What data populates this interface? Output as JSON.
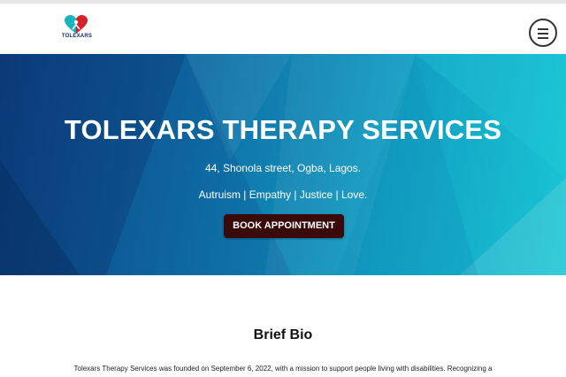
{
  "header": {
    "logo_text": "TOLEXARS",
    "logo_subtext": "",
    "menu_icon": "hamburger-icon"
  },
  "hero": {
    "title": "TOLEXARS THERAPY SERVICES",
    "address": "44, Shonola street, Ogba, Lagos.",
    "tagline": "Autruism | Empathy | Justice | Love.",
    "cta_label": "BOOK APPOINTMENT"
  },
  "bio": {
    "title": "Brief Bio",
    "text": "Tolexars Therapy Services was founded on September 6, 2022, with a mission to support people living with disabilities. Recognizing a"
  },
  "colors": {
    "hero_start": "#0d3f80",
    "hero_end": "#19c6d3",
    "cta_background": "#3a0a0a",
    "logo_heart_red": "#d3222a",
    "logo_heart_teal": "#16b3c1"
  }
}
